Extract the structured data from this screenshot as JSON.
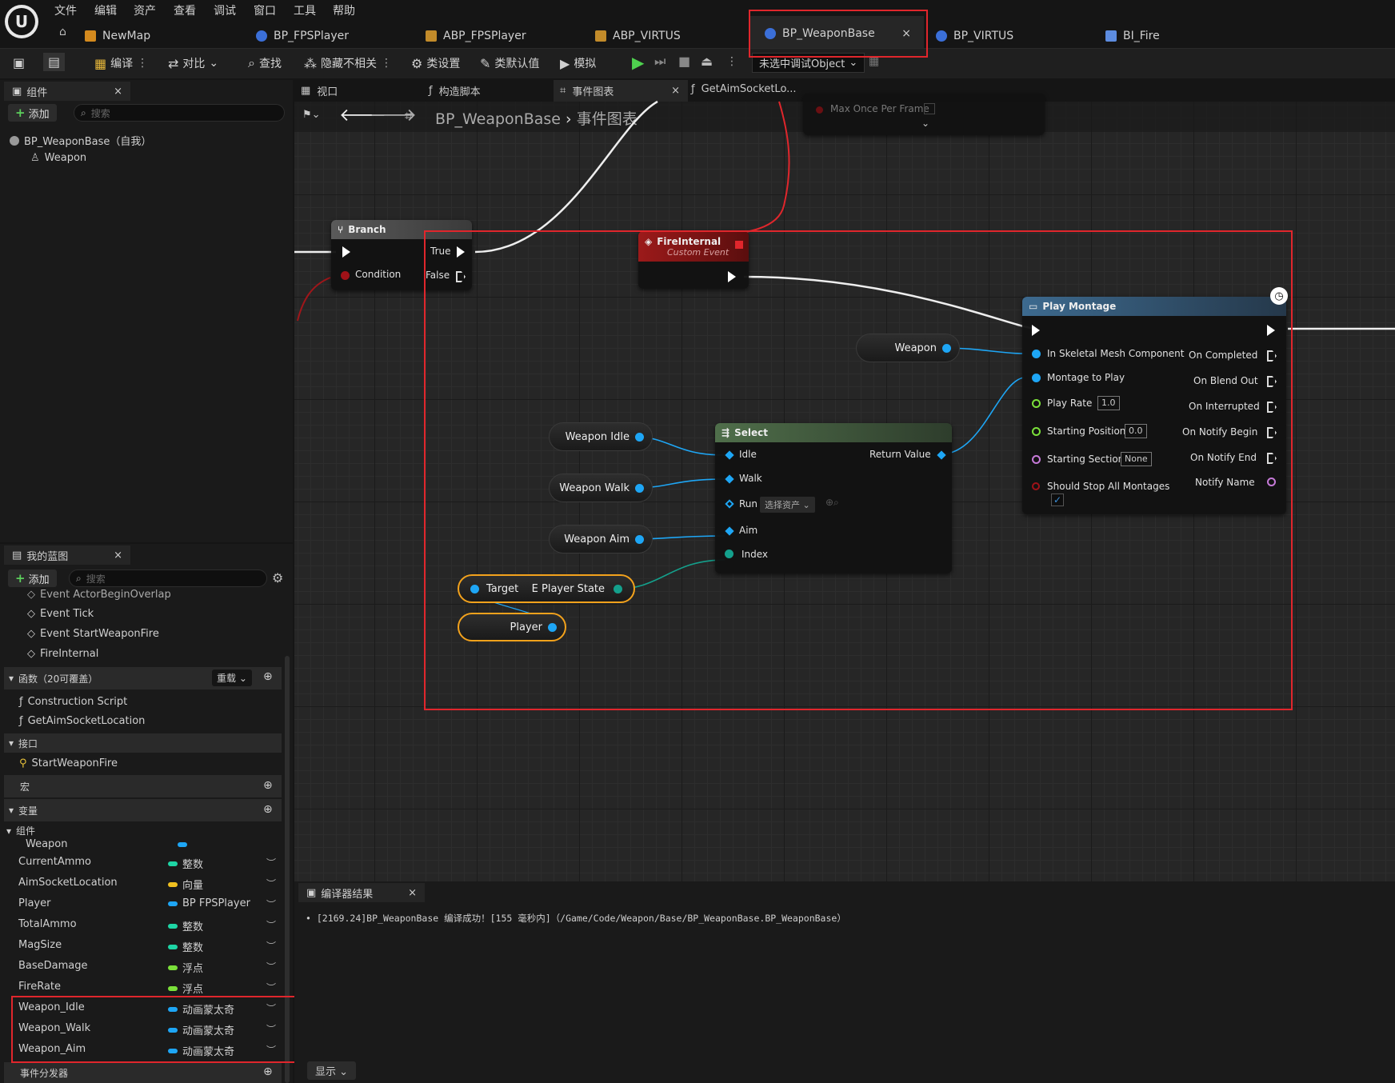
{
  "menu": [
    "文件",
    "编辑",
    "资产",
    "查看",
    "调试",
    "窗口",
    "工具",
    "帮助"
  ],
  "tabs": [
    {
      "label": "NewMap"
    },
    {
      "label": "BP_FPSPlayer"
    },
    {
      "label": "ABP_FPSPlayer"
    },
    {
      "label": "ABP_VIRTUS"
    },
    {
      "label": "BP_WeaponBase",
      "close": "×"
    },
    {
      "label": "BP_VIRTUS"
    },
    {
      "label": "BI_Fire"
    }
  ],
  "toolbar": {
    "compile": "编译",
    "diff": "对比",
    "find": "查找",
    "hide_unrelated": "隐藏不相关",
    "class_settings": "类设置",
    "class_defaults": "类默认值",
    "simulate": "模拟",
    "debug_object": "未选中调试Object"
  },
  "components_panel": {
    "title": "组件",
    "add": "添加",
    "search_placeholder": "搜索",
    "root": "BP_WeaponBase（自我）",
    "child": "Weapon"
  },
  "editor_tabs": {
    "viewport": "视口",
    "construction": "构造脚本",
    "event_graph": "事件图表",
    "getaim": "GetAimSocketLo..."
  },
  "breadcrumb": {
    "blueprint": "BP_WeaponBase",
    "graph": "事件图表"
  },
  "my_blueprint": {
    "title": "我的蓝图",
    "add": "添加",
    "search_placeholder": "搜索",
    "events": [
      "Event ActorBeginOverlap",
      "Event Tick",
      "Event StartWeaponFire",
      "FireInternal"
    ],
    "functions_header": "函数（20可覆盖）",
    "override": "重载",
    "functions": [
      "Construction Script",
      "GetAimSocketLocation"
    ],
    "interfaces_header": "接口",
    "interfaces": [
      "StartWeaponFire"
    ],
    "macros_header": "宏",
    "variables_header": "变量",
    "components_group": "组件",
    "component_var": "Weapon",
    "variables": [
      {
        "name": "CurrentAmmo",
        "type": "整数",
        "color": "#1ed5a5"
      },
      {
        "name": "AimSocketLocation",
        "type": "向量",
        "color": "#f0c020"
      },
      {
        "name": "Player",
        "type": "BP FPSPlayer",
        "color": "#1ea6f5"
      },
      {
        "name": "TotalAmmo",
        "type": "整数",
        "color": "#1ed5a5"
      },
      {
        "name": "MagSize",
        "type": "整数",
        "color": "#1ed5a5"
      },
      {
        "name": "BaseDamage",
        "type": "浮点",
        "color": "#7be03a"
      },
      {
        "name": "FireRate",
        "type": "浮点",
        "color": "#7be03a"
      },
      {
        "name": "Weapon_Idle",
        "type": "动画蒙太奇",
        "color": "#1ea6f5"
      },
      {
        "name": "Weapon_Walk",
        "type": "动画蒙太奇",
        "color": "#1ea6f5"
      },
      {
        "name": "Weapon_Aim",
        "type": "动画蒙太奇",
        "color": "#1ea6f5"
      }
    ],
    "dispatchers_header": "事件分发器"
  },
  "graph": {
    "top_node": {
      "pin": "Max Once Per Frame"
    },
    "branch": {
      "title": "Branch",
      "true": "True",
      "false": "False",
      "condition": "Condition"
    },
    "fire_internal": {
      "title": "FireInternal",
      "subtitle": "Custom Event"
    },
    "play_montage": {
      "title": "Play Montage",
      "inputs": [
        "In Skeletal Mesh Component",
        "Montage to Play",
        "Play Rate",
        "Starting Position",
        "Starting Section",
        "Should Stop All Montages"
      ],
      "outputs": [
        "On Completed",
        "On Blend Out",
        "On Interrupted",
        "On Notify Begin",
        "On Notify End",
        "Notify Name"
      ],
      "play_rate": "1.0",
      "starting_position": "0.0",
      "starting_section": "None"
    },
    "weapon_var": "Weapon",
    "select": {
      "title": "Select",
      "options": [
        "Idle",
        "Walk",
        "Run",
        "Aim"
      ],
      "index": "Index",
      "return": "Return Value",
      "asset_picker": "选择资产"
    },
    "vars": {
      "idle": "Weapon Idle",
      "walk": "Weapon Walk",
      "aim": "Weapon Aim",
      "player": "Player"
    },
    "target_node": {
      "target": "Target",
      "state": "E Player State"
    }
  },
  "compiler": {
    "title": "编译器结果",
    "message": "[2169.24]BP_WeaponBase 编译成功！[155 毫秒内]（/Game/Code/Weapon/Base/BP_WeaponBase.BP_WeaponBase）",
    "show": "显示"
  }
}
